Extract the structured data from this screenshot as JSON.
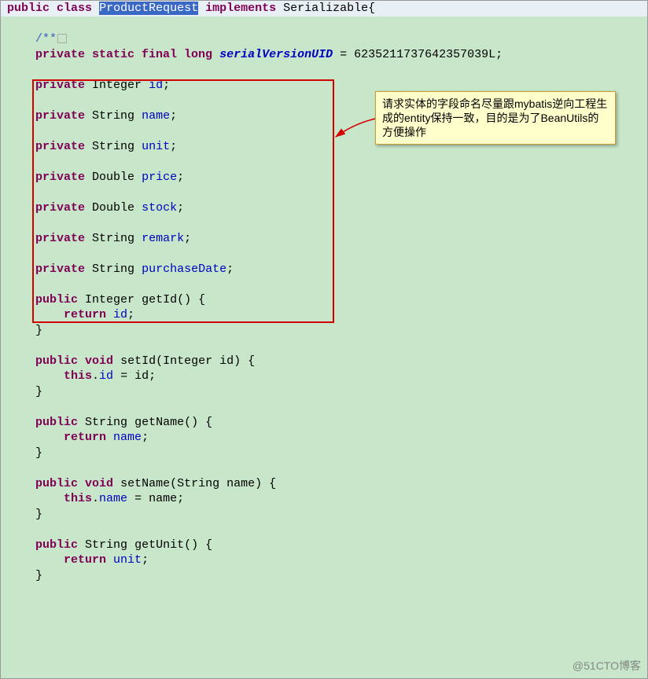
{
  "code": {
    "declLine": {
      "kwPublic": "public",
      "kwClass": "class",
      "className": "ProductRequest",
      "kwImplements": "implements",
      "iface": "Serializable",
      "open": "{"
    },
    "comment": "/**",
    "serialLine": {
      "mods": "private static final long",
      "name": "serialVersionUID",
      "eq": " = ",
      "value": "6235211737642357039L",
      "semi": ";"
    },
    "fields": [
      {
        "kw": "private",
        "type": "Integer",
        "name": "id"
      },
      {
        "kw": "private",
        "type": "String",
        "name": "name"
      },
      {
        "kw": "private",
        "type": "String",
        "name": "unit"
      },
      {
        "kw": "private",
        "type": "Double",
        "name": "price"
      },
      {
        "kw": "private",
        "type": "Double",
        "name": "stock"
      },
      {
        "kw": "private",
        "type": "String",
        "name": "remark"
      },
      {
        "kw": "private",
        "type": "String",
        "name": "purchaseDate"
      }
    ],
    "methods": [
      {
        "sig": {
          "mods": "public",
          "ret": "Integer",
          "name": "getId",
          "params": "()"
        },
        "body": {
          "kw": "return",
          "ident": "id"
        }
      },
      {
        "sig": {
          "mods": "public void",
          "name": "setId",
          "params": "(Integer id)"
        },
        "body": {
          "kw": "this",
          "dot": ".",
          "ident": "id",
          "assign": " = id"
        }
      },
      {
        "sig": {
          "mods": "public",
          "ret": "String",
          "name": "getName",
          "params": "()"
        },
        "body": {
          "kw": "return",
          "ident": "name"
        }
      },
      {
        "sig": {
          "mods": "public void",
          "name": "setName",
          "params": "(String name)"
        },
        "body": {
          "kw": "this",
          "dot": ".",
          "ident": "name",
          "assign": " = name"
        }
      },
      {
        "sig": {
          "mods": "public",
          "ret": "String",
          "name": "getUnit",
          "params": "()"
        },
        "body": {
          "kw": "return",
          "ident": "unit"
        }
      }
    ]
  },
  "annotation": {
    "text": "请求实体的字段命名尽量跟mybatis逆向工程生成的entity保持一致，目的是为了BeanUtils的方便操作"
  },
  "watermark": "@51CTO博客"
}
